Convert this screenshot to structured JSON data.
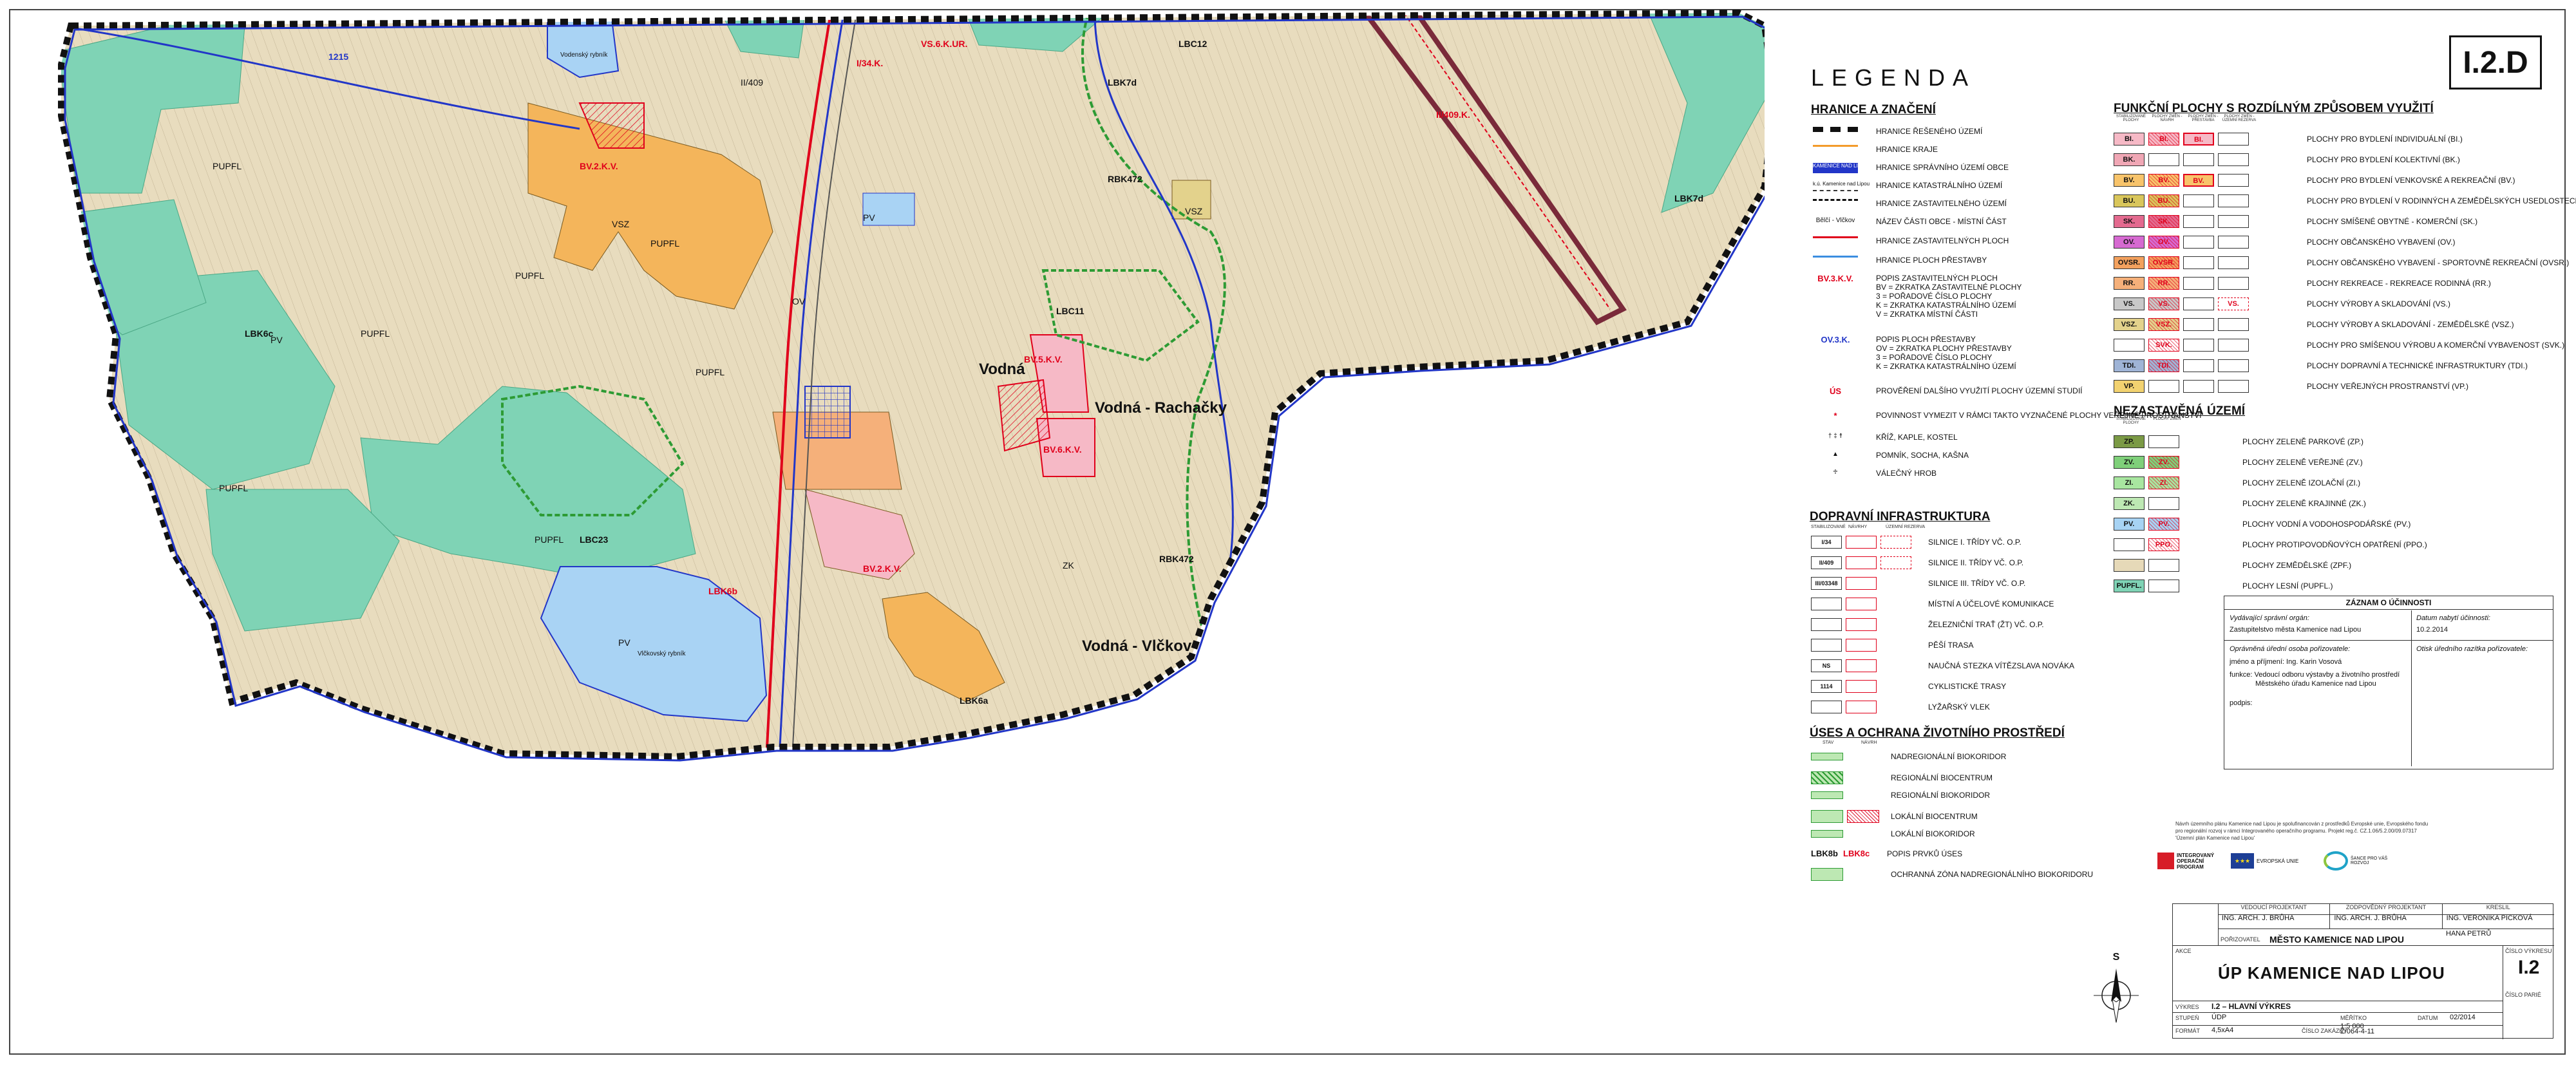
{
  "sheet_code": "I.2.D",
  "map": {
    "place_labels": [
      {
        "text": "Vodná",
        "style": "dark big"
      },
      {
        "text": "Vodná - Rachačky",
        "style": "dark big"
      },
      {
        "text": "Vodná - Vlčkov",
        "style": "dark big"
      },
      {
        "text": "BV.2.K.V.",
        "style": "red"
      },
      {
        "text": "BV.5.K.V.",
        "style": "red"
      },
      {
        "text": "BV.6.K.V.",
        "style": "red"
      },
      {
        "text": "BV.2.K.V.",
        "style": "red"
      },
      {
        "text": "II/409.K.",
        "style": "red"
      },
      {
        "text": "I/34.K.",
        "style": "red"
      },
      {
        "text": "VS.6.K.UR.",
        "style": "red"
      },
      {
        "text": "LBC12",
        "style": "dark"
      },
      {
        "text": "LBC11",
        "style": "dark"
      },
      {
        "text": "LBC23",
        "style": "dark"
      },
      {
        "text": "LBK7d",
        "style": "dark"
      },
      {
        "text": "LBK7d",
        "style": "dark"
      },
      {
        "text": "LBK6c",
        "style": "dark"
      },
      {
        "text": "LBK6b",
        "style": "red"
      },
      {
        "text": "LBK6a",
        "style": "dark"
      },
      {
        "text": "RBK472",
        "style": "dark"
      },
      {
        "text": "RBK472",
        "style": "dark"
      },
      {
        "text": "PUPFL",
        "style": ""
      },
      {
        "text": "PUPFL",
        "style": ""
      },
      {
        "text": "PUPFL",
        "style": ""
      },
      {
        "text": "PUPFL",
        "style": ""
      },
      {
        "text": "PUPFL",
        "style": ""
      },
      {
        "text": "PUPFL",
        "style": ""
      },
      {
        "text": "PUPFL",
        "style": ""
      },
      {
        "text": "PV",
        "style": ""
      },
      {
        "text": "PV",
        "style": ""
      },
      {
        "text": "PV",
        "style": ""
      },
      {
        "text": "ZK",
        "style": ""
      },
      {
        "text": "VSZ",
        "style": ""
      },
      {
        "text": "VSZ",
        "style": ""
      },
      {
        "text": "OV",
        "style": ""
      },
      {
        "text": "1215",
        "style": "blue"
      },
      {
        "text": "II/409",
        "style": ""
      },
      {
        "text": "Vlčkovský rybník",
        "style": ""
      },
      {
        "text": "Vodenský rybník",
        "style": ""
      }
    ]
  },
  "legend": {
    "title": "LEGENDA",
    "boundaries": {
      "title": "HRANICE A ZNAČENÍ",
      "items": [
        {
          "sym": "dash-thick",
          "label": "HRANICE ŘEŠENÉHO ÚZEMÍ"
        },
        {
          "sym": "orange",
          "label": "HRANICE KRAJE"
        },
        {
          "sym": "blue-text",
          "sym_text": "KAMENICE NAD LIPOU",
          "label": "HRANICE SPRÁVNÍHO ÚZEMÍ OBCE"
        },
        {
          "sym": "gray-text",
          "sym_text": "k.ú. Kamenice nad Lipou",
          "label": "HRANICE KATASTRÁLNÍHO ÚZEMÍ"
        },
        {
          "sym": "dash-thin",
          "label": "HRANICE ZASTAVITELNÉHO ÚZEMÍ"
        },
        {
          "sym": "text",
          "sym_text": "Bělčí - Vlčkov",
          "label": "NÁZEV ČÁSTI OBCE - MÍSTNÍ ČÁST"
        },
        {
          "sym": "red-line",
          "label": "HRANICE ZASTAVITELNÝCH PLOCH"
        },
        {
          "sym": "blue-line",
          "label": "HRANICE PLOCH PŘESTAVBY"
        },
        {
          "sym": "red-text",
          "sym_text": "BV.3.K.V.",
          "label": "POPIS ZASTAVITELNÝCH PLOCH",
          "notes": [
            "BV = ZKRATKA ZASTAVITELNÉ PLOCHY",
            "3 = POŘADOVÉ ČÍSLO PLOCHY",
            "K = ZKRATKA KATASTRÁLNÍHO ÚZEMÍ",
            "V = ZKRATKA MÍSTNÍ ČÁSTI"
          ]
        },
        {
          "sym": "blue-text2",
          "sym_text": "OV.3.K.",
          "label": "POPIS PLOCH PŘESTAVBY",
          "notes": [
            "OV = ZKRATKA PLOCHY PŘESTAVBY",
            "3 = POŘADOVÉ ČÍSLO PLOCHY",
            "K = ZKRATKA KATASTRÁLNÍHO ÚZEMÍ"
          ]
        },
        {
          "sym": "red-us",
          "sym_text": "ÚS",
          "label": "PROVĚŘENÍ DALŠÍHO VYUŽITÍ PLOCHY ÚZEMNÍ STUDIÍ"
        },
        {
          "sym": "star",
          "sym_text": "*",
          "label": "POVINNOST VYMEZIT V RÁMCI TAKTO VYZNAČENÉ PLOCHY VEŘEJNÉ PROSTRANSTVÍ"
        },
        {
          "sym": "crosses",
          "sym_text": "† ‡ ☨",
          "label": "KŘÍŽ, KAPLE, KOSTEL"
        },
        {
          "sym": "monument",
          "sym_text": "▲",
          "label": "POMNÍK, SOCHA, KAŠNA"
        },
        {
          "sym": "grave",
          "sym_text": "♱",
          "label": "VÁLEČNÝ HROB"
        }
      ]
    },
    "transport": {
      "title": "DOPRAVNÍ INFRASTRUKTURA",
      "headers": [
        "STABILIZOVANÉ",
        "NÁVRHY",
        "ÚZEMNÍ REZERVA"
      ],
      "items": [
        {
          "code": "I/34",
          "label": "SILNICE I. TŘÍDY VČ. O.P."
        },
        {
          "code": "II/409",
          "label": "SILNICE II. TŘÍDY VČ. O.P."
        },
        {
          "code": "III/03348",
          "label": "SILNICE III. TŘÍDY VČ. O.P."
        },
        {
          "code": "",
          "label": "MÍSTNÍ A ÚČELOVÉ KOMUNIKACE"
        },
        {
          "code": "",
          "label": "ŽELEZNIČNÍ TRAŤ (ŽT) VČ. O.P."
        },
        {
          "code": "",
          "label": "PĚŠÍ TRASA"
        },
        {
          "code": "NS",
          "label": "NAUČNÁ STEZKA VÍTĚZSLAVA NOVÁKA"
        },
        {
          "code": "1114",
          "label": "CYKLISTICKÉ TRASY"
        },
        {
          "code": "",
          "label": "LYŽAŘSKÝ VLEK"
        }
      ]
    },
    "environment": {
      "title": "ÚSES A OCHRANA ŽIVOTNÍHO PROSTŘEDÍ",
      "headers": [
        "STAV",
        "NÁVRH"
      ],
      "items": [
        {
          "label": "NADREGIONÁLNÍ BIOKORIDOR"
        },
        {
          "label": "REGIONÁLNÍ BIOCENTRUM"
        },
        {
          "label": "REGIONÁLNÍ BIOKORIDOR"
        },
        {
          "label": "LOKÁLNÍ BIOCENTRUM"
        },
        {
          "label": "LOKÁLNÍ BIOKORIDOR"
        },
        {
          "label": "POPIS PRVKŮ ÚSES",
          "codes": [
            "LBK8b",
            "LBK8c"
          ]
        },
        {
          "label": "OCHRANNÁ ZÓNA NADREGIONÁLNÍHO BIOKORIDORU"
        }
      ]
    },
    "functional": {
      "title": "FUNKČNÍ PLOCHY S ROZDÍLNÝM ZPŮSOBEM VYUŽITÍ",
      "headers": [
        "STABILIZOVANÉ PLOCHY",
        "PLOCHY ZMĚN - NÁVRH",
        "PLOCHY ZMĚN - PŘESTAVBA",
        "PLOCHY ZMĚN - ÚZEMNÍ REZERVA"
      ],
      "items": [
        {
          "code": "BI.",
          "color": "#f6b9c6",
          "cols": [
            1,
            1,
            1,
            0
          ],
          "label": "PLOCHY PRO BYDLENÍ INDIVIDUÁLNÍ (BI.)"
        },
        {
          "code": "BK.",
          "color": "#f0a7b5",
          "cols": [
            1,
            0,
            0,
            0
          ],
          "label": "PLOCHY PRO BYDLENÍ KOLEKTIVNÍ (BK.)"
        },
        {
          "code": "BV.",
          "color": "#f8c46b",
          "cols": [
            1,
            1,
            1,
            0
          ],
          "label": "PLOCHY PRO BYDLENÍ VENKOVSKÉ A REKREAČNÍ (BV.)"
        },
        {
          "code": "BU.",
          "color": "#d9c65b",
          "cols": [
            1,
            1,
            0,
            0
          ],
          "label": "PLOCHY PRO BYDLENÍ V RODINNÝCH A ZEMĚDĚLSKÝCH USEDLOSTECH (BU.)"
        },
        {
          "code": "SK.",
          "color": "#e36a8f",
          "cols": [
            1,
            1,
            0,
            0
          ],
          "label": "PLOCHY SMÍŠENÉ OBYTNÉ - KOMERČNÍ (SK.)"
        },
        {
          "code": "OV.",
          "color": "#d66ad1",
          "cols": [
            1,
            1,
            0,
            0
          ],
          "label": "PLOCHY OBČANSKÉHO VYBAVENÍ (OV.)"
        },
        {
          "code": "OVSR.",
          "color": "#f3a15e",
          "cols": [
            1,
            1,
            0,
            0
          ],
          "label": "PLOCHY OBČANSKÉHO VYBAVENÍ - SPORTOVNĚ REKREAČNÍ (OVSR.)"
        },
        {
          "code": "RR.",
          "color": "#f5b07a",
          "cols": [
            1,
            1,
            0,
            0
          ],
          "label": "PLOCHY REKREACE - REKREACE RODINNÁ (RR.)"
        },
        {
          "code": "VS.",
          "color": "#c8c8c8",
          "cols": [
            1,
            1,
            0,
            1
          ],
          "label": "PLOCHY VÝROBY A SKLADOVÁNÍ (VS.)"
        },
        {
          "code": "VSZ.",
          "color": "#e3d28c",
          "cols": [
            1,
            1,
            0,
            0
          ],
          "label": "PLOCHY VÝROBY A SKLADOVÁNÍ - ZEMĚDĚLSKÉ (VSZ.)"
        },
        {
          "code": "SVK.",
          "color": "#ffffff",
          "cols": [
            0,
            1,
            0,
            0
          ],
          "label": "PLOCHY PRO SMÍŠENOU VÝROBU A KOMERČNÍ VYBAVENOST (SVK.)"
        },
        {
          "code": "TDI.",
          "color": "#9fb4d6",
          "cols": [
            1,
            1,
            0,
            0
          ],
          "label": "PLOCHY DOPRAVNÍ A TECHNICKÉ INFRASTRUKTURY (TDI.)"
        },
        {
          "code": "VP.",
          "color": "#f2d270",
          "cols": [
            1,
            0,
            0,
            0
          ],
          "label": "PLOCHY VEŘEJNÝCH PROSTRANSTVÍ (VP.)"
        }
      ]
    },
    "unbuilt": {
      "title": "NEZASTAVĚNÁ ÚZEMÍ",
      "headers": [
        "STABILIZOVANÉ PLOCHY",
        "PLOCHY ZMĚN"
      ],
      "items": [
        {
          "code": "ZP.",
          "color": "#7b9a45",
          "cols": [
            1,
            0
          ],
          "label": "PLOCHY ZELENĚ PARKOVÉ (ZP.)"
        },
        {
          "code": "ZV.",
          "color": "#7fd07a",
          "cols": [
            1,
            1
          ],
          "label": "PLOCHY ZELENĚ VEŘEJNÉ (ZV.)"
        },
        {
          "code": "ZI.",
          "color": "#a8e6a0",
          "cols": [
            1,
            1
          ],
          "label": "PLOCHY ZELENĚ IZOLAČNÍ (ZI.)"
        },
        {
          "code": "ZK.",
          "color": "#bde8b3",
          "cols": [
            1,
            0
          ],
          "label": "PLOCHY ZELENĚ KRAJINNÉ (ZK.)"
        },
        {
          "code": "PV.",
          "color": "#a7d3f4",
          "cols": [
            1,
            1
          ],
          "label": "PLOCHY VODNÍ A VODOHOSPODÁŘSKÉ (PV.)"
        },
        {
          "code": "PPO.",
          "color": "#ffffff",
          "cols": [
            0,
            1
          ],
          "label": "PLOCHY PROTIPOVODŇOVÝCH OPATŘENÍ (PPO.)"
        },
        {
          "code": "",
          "color": "#e6d9b8",
          "cols": [
            1,
            0
          ],
          "label": "PLOCHY ZEMĚDĚLSKÉ (ZPF.)"
        },
        {
          "code": "PUPFL.",
          "color": "#7fd3b5",
          "cols": [
            1,
            0
          ],
          "label": "PLOCHY LESNÍ (PUPFL.)"
        }
      ]
    }
  },
  "effectiveness": {
    "title": "ZÁZNAM O ÚČINNOSTI",
    "issuer_label": "Vydávající správní orgán:",
    "issuer": "Zastupitelstvo města Kamenice nad Lipou",
    "date_label": "Datum nabytí účinnosti:",
    "date": "10.2.2014",
    "official_label": "Oprávněná úřední osoba pořizovatele:",
    "name_line": "jméno a příjmení: Ing. Karin Vosová",
    "function_line_1": "funkce: Vedoucí odboru výstavby a životního prostředí",
    "function_line_2": "Městského úřadu Kamenice nad Lipou",
    "signature_line": "podpis:",
    "stamp_label": "Otisk úředního razítka pořizovatele:"
  },
  "funding_text": "Návrh územního plánu Kamenice nad Lipou je spolufinancován z prostředků Evropské unie, Evropského fondu pro regionální rozvoj v rámci Integrovaného operačního programu. Projekt reg.č. CZ.1.06/5.2.00/09.07317 'Územní plán Kamenice nad Lipou'",
  "logos": [
    "INTEGROVANÝ OPERAČNÍ PROGRAM",
    "EVROPSKÁ UNIE",
    "ŠANCE PRO VÁŠ ROZVOJ"
  ],
  "title_block": {
    "roles": [
      "VEDOUCÍ PROJEKTANT",
      "ZODPOVĚDNÝ PROJEKTANT",
      "KRESLIL"
    ],
    "persons": [
      "ING. ARCH. J. BRŮHA",
      "ING. ARCH. J. BRŮHA",
      "ING. VERONIKA PICKOVÁ",
      "HANA PETRŮ"
    ],
    "client_label": "POŘIZOVATEL",
    "client": "MĚSTO KAMENICE NAD LIPOU",
    "project_label": "AKCE",
    "project": "ÚP KAMENICE NAD LIPOU",
    "sheet_label": "ČÍSLO VÝKRESU",
    "sheet": "I.2",
    "part_label": "ČÍSLO PARIÉ",
    "drawing_label": "VÝKRES",
    "drawing": "I.2 – HLAVNÍ VÝKRES",
    "stage_label": "STUPEŇ",
    "stage": "ÚDP",
    "scale_label": "MĚŘÍTKO",
    "scale": "1:5 000",
    "date_label": "DATUM",
    "date": "02/2014",
    "format_label": "FORMÁT",
    "format": "4,5xA4",
    "order_label": "ČÍSLO ZAKÁZKY",
    "order": "Z/064-4-11"
  },
  "north_arrow": "S",
  "colors": {
    "agri": "#e8dcbe",
    "forest": "#7fd3b5",
    "water": "#a9d3f4",
    "settlement": "#f4b55b",
    "build_pink": "#f6b9c6",
    "boundary": "#1f1f1f",
    "road_red": "#e0001b",
    "road_blue": "#2236c8"
  }
}
